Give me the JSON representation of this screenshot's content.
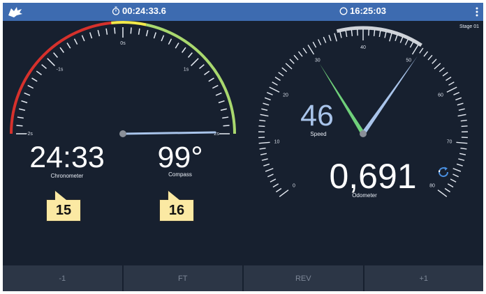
{
  "topbar": {
    "stopwatch_time": "00:24:33.6",
    "clock_time": "16:25:03"
  },
  "stage_label": "Stage 01",
  "chronometer_gauge": {
    "tick_labels": [
      "-2s",
      "-1s",
      "0s",
      "1s",
      "2s"
    ],
    "value": 2.0,
    "range": [
      -2,
      2
    ],
    "colors": {
      "red": "#d6312c",
      "yellow": "#f2e94a",
      "green": "#a9d86e",
      "needle": "#a9c4ea"
    }
  },
  "chronometer": {
    "value": "24:33",
    "label": "Chronometer"
  },
  "compass": {
    "value": "99°",
    "label": "Compass"
  },
  "speed_gauge": {
    "tick_labels": [
      "0",
      "10",
      "20",
      "30",
      "40",
      "50",
      "60",
      "70",
      "80"
    ],
    "range": [
      0,
      80
    ],
    "needle_value": 51,
    "green_needle_value": 30,
    "colors": {
      "needle": "#a9c4ea",
      "green_needle": "#6fd07a"
    }
  },
  "speed": {
    "value": "46",
    "label": "Speed"
  },
  "odometer": {
    "value": "0,691",
    "label": "Odometer"
  },
  "refresh_icon": "refresh-icon",
  "callouts": [
    "15",
    "16"
  ],
  "bottom_buttons": {
    "minus_one": "-1",
    "ft": "FT",
    "rev": "REV",
    "plus_one": "+1"
  }
}
